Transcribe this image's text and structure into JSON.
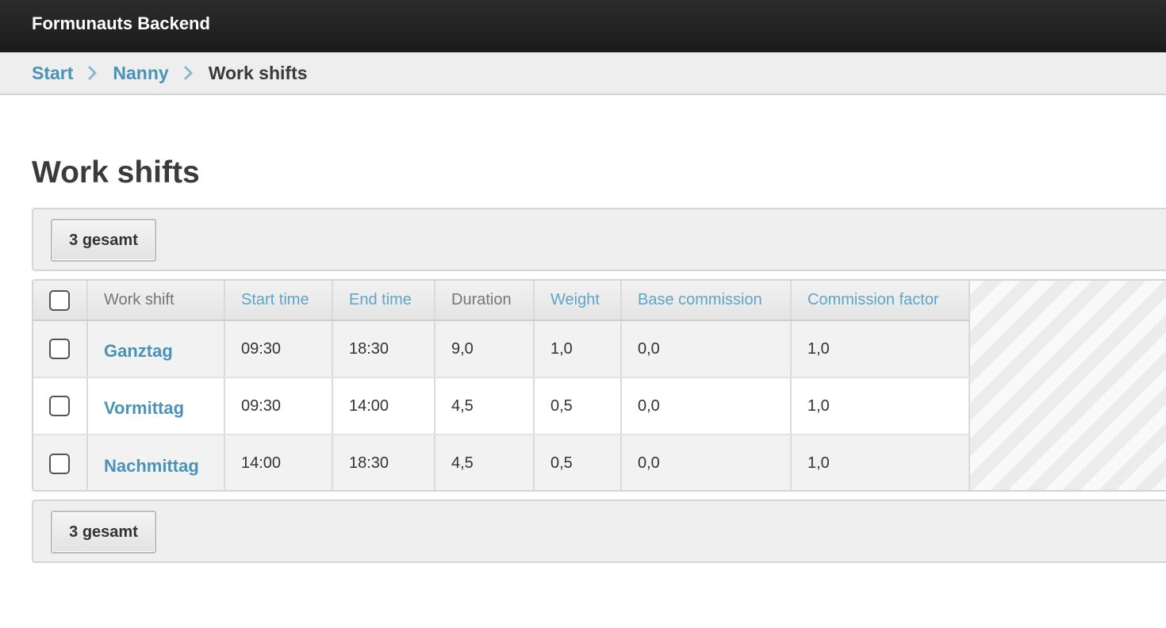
{
  "app": {
    "title": "Formunauts Backend"
  },
  "breadcrumb": [
    {
      "label": "Start",
      "current": false
    },
    {
      "label": "Nanny",
      "current": false
    },
    {
      "label": "Work shifts",
      "current": true
    }
  ],
  "page": {
    "title": "Work shifts"
  },
  "pagination": {
    "count_label": "3 gesamt"
  },
  "table": {
    "columns": [
      {
        "label": "Work shift",
        "sortable": false
      },
      {
        "label": "Start time",
        "sortable": true
      },
      {
        "label": "End time",
        "sortable": true
      },
      {
        "label": "Duration",
        "sortable": false
      },
      {
        "label": "Weight",
        "sortable": true
      },
      {
        "label": "Base commission",
        "sortable": true
      },
      {
        "label": "Commission factor",
        "sortable": true
      }
    ],
    "rows": [
      {
        "name": "Ganztag",
        "start": "09:30",
        "end": "18:30",
        "duration": "9,0",
        "weight": "1,0",
        "base_commission": "0,0",
        "commission_factor": "1,0",
        "checked": false
      },
      {
        "name": "Vormittag",
        "start": "09:30",
        "end": "14:00",
        "duration": "4,5",
        "weight": "0,5",
        "base_commission": "0,0",
        "commission_factor": "1,0",
        "checked": false
      },
      {
        "name": "Nachmittag",
        "start": "14:00",
        "end": "18:30",
        "duration": "4,5",
        "weight": "0,5",
        "base_commission": "0,0",
        "commission_factor": "1,0",
        "checked": false
      }
    ]
  },
  "colors": {
    "link": "#4a93b6",
    "sortable_header": "#5ea6c8",
    "topbar": "#222222",
    "crumbbar": "#eeeeee"
  },
  "icons": {
    "breadcrumb_separator": "chevron-right-icon"
  }
}
